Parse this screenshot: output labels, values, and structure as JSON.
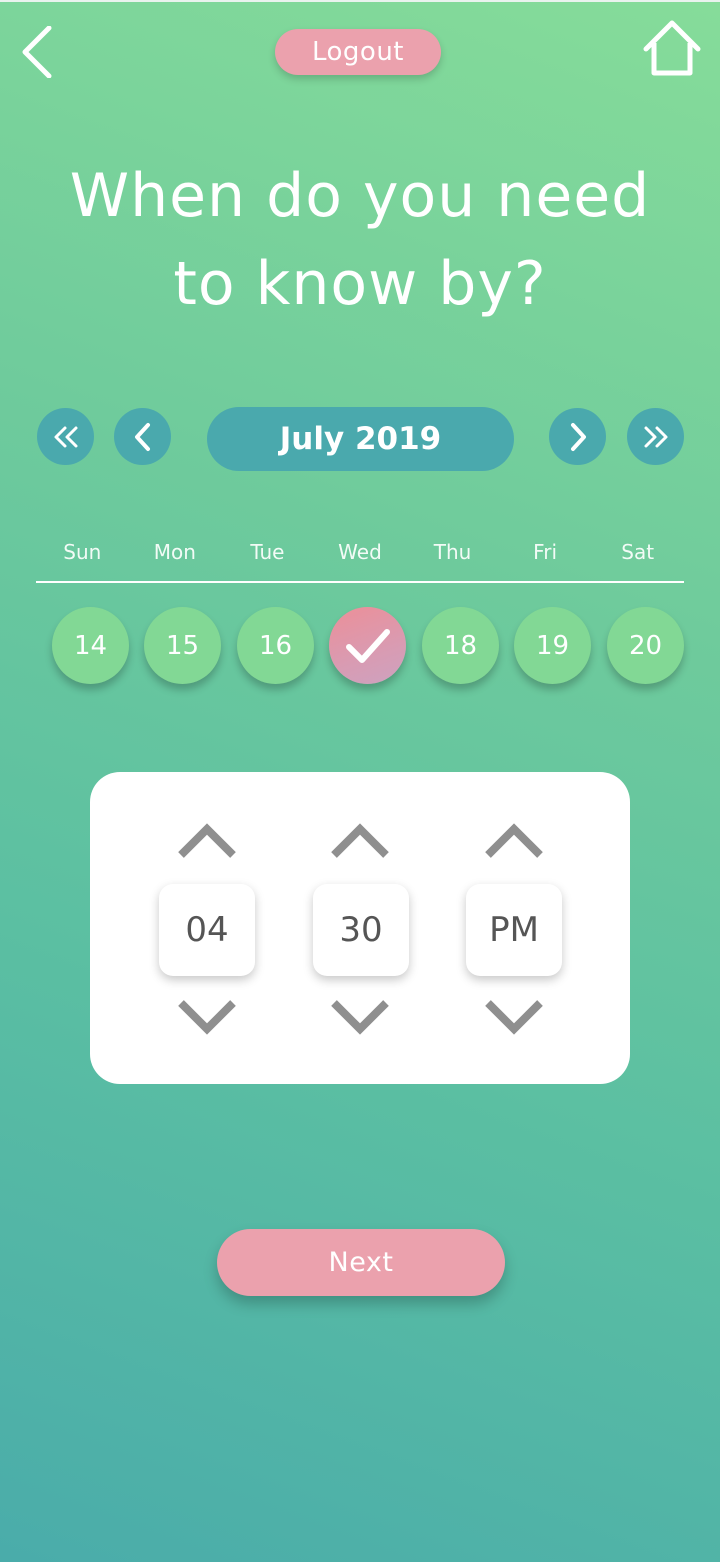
{
  "header": {
    "back_icon": "chevron-left-icon",
    "logout_label": "Logout",
    "home_icon": "home-icon"
  },
  "title": {
    "line1": "When do you need",
    "line2": "to know by?"
  },
  "calendar": {
    "month_label": "July 2019",
    "prev_year_icon": "double-chevron-left-icon",
    "prev_month_icon": "chevron-left-icon",
    "next_month_icon": "chevron-right-icon",
    "next_year_icon": "double-chevron-right-icon",
    "weekdays": [
      "Sun",
      "Mon",
      "Tue",
      "Wed",
      "Thu",
      "Fri",
      "Sat"
    ],
    "days": [
      "14",
      "15",
      "16",
      "",
      "18",
      "19",
      "20"
    ],
    "selected_day_icon": "checkmark-icon"
  },
  "time_picker": {
    "hour": "04",
    "minute": "30",
    "period": "PM",
    "up_icon": "chevron-up-icon",
    "down_icon": "chevron-down-icon"
  },
  "next_label": "Next",
  "colors": {
    "accent_pink": "#eba1ad",
    "teal": "#4aa9ad",
    "day_green": "#82d895",
    "bg_top": "#86dc9a",
    "bg_bottom": "#4aacaa"
  }
}
